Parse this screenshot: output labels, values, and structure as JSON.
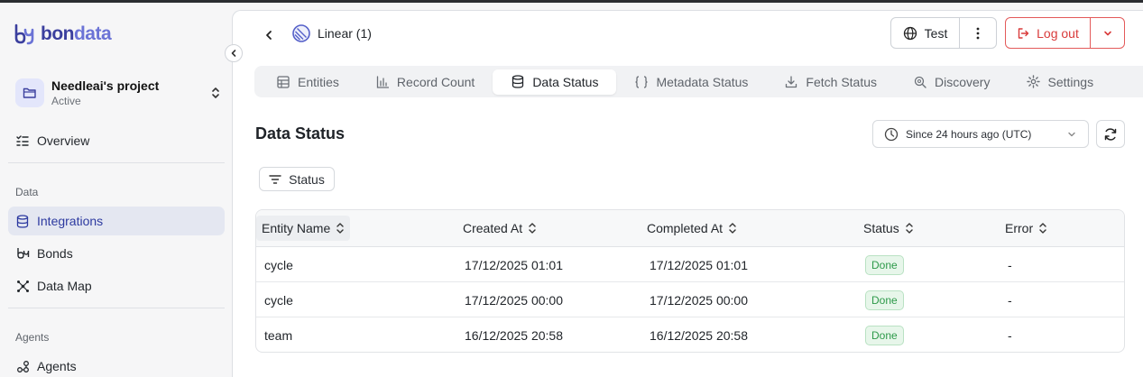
{
  "brand": {
    "name_part1": "bon",
    "name_part2": "data"
  },
  "project": {
    "name": "Needleai's project",
    "status": "Active"
  },
  "sidebar": {
    "overview": "Overview",
    "section_data": "Data",
    "integrations": "Integrations",
    "bonds": "Bonds",
    "data_map": "Data Map",
    "section_agents": "Agents",
    "agents": "Agents"
  },
  "header": {
    "integration_title": "Linear (1)",
    "test_label": "Test",
    "logout_label": "Log out"
  },
  "tabs": [
    {
      "label": "Entities",
      "icon": "grid-icon"
    },
    {
      "label": "Record Count",
      "icon": "bar-chart-icon"
    },
    {
      "label": "Data Status",
      "icon": "database-icon",
      "active": true
    },
    {
      "label": "Metadata Status",
      "icon": "braces-icon"
    },
    {
      "label": "Fetch Status",
      "icon": "download-icon"
    },
    {
      "label": "Discovery",
      "icon": "search-icon"
    },
    {
      "label": "Settings",
      "icon": "gear-icon"
    }
  ],
  "page": {
    "title": "Data Status",
    "time_range": "Since 24 hours ago (UTC)",
    "filter_label": "Status"
  },
  "table": {
    "columns": [
      "Entity Name",
      "Created At",
      "Completed At",
      "Status",
      "Error"
    ],
    "rows": [
      {
        "entity": "cycle",
        "created": "17/12/2025 01:01",
        "completed": "17/12/2025 01:01",
        "status": "Done",
        "error": "-"
      },
      {
        "entity": "cycle",
        "created": "17/12/2025 00:00",
        "completed": "17/12/2025 00:00",
        "status": "Done",
        "error": "-"
      },
      {
        "entity": "team",
        "created": "16/12/2025 20:58",
        "completed": "16/12/2025 20:58",
        "status": "Done",
        "error": "-"
      }
    ]
  },
  "colors": {
    "accent": "#3b3f9e",
    "danger": "#d93b3b",
    "success": "#2e9a4a"
  }
}
